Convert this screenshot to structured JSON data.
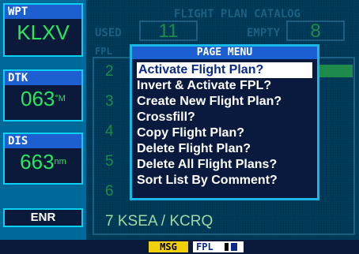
{
  "sidebar": {
    "wpt": {
      "label": "WPT",
      "value": "KLXV"
    },
    "dtk": {
      "label": "DTK",
      "value": "063",
      "unit": "°M"
    },
    "dis": {
      "label": "DIS",
      "value": "663",
      "unit": "nm"
    },
    "mode": "ENR"
  },
  "catalog": {
    "title": "FLIGHT PLAN CATALOG",
    "used_label": "USED",
    "used_value": "11",
    "empty_label": "EMPTY",
    "empty_value": "8",
    "fpl_label": "FPL",
    "rows": [
      "2",
      "3",
      "4",
      "5",
      "6",
      "7 KSEA / KCRQ"
    ]
  },
  "menu": {
    "title": "PAGE MENU",
    "items": [
      "Activate Flight Plan?",
      "Invert & Activate FPL?",
      "Create New Flight Plan?",
      "Crossfill?",
      "Copy Flight Plan?",
      "Delete Flight Plan?",
      "Delete All Flight Plans?",
      "Sort List By Comment?"
    ]
  },
  "status_bar": {
    "msg": "MSG",
    "page": "FPL"
  },
  "colors": {
    "accent_cyan": "#0cd0f0",
    "value_green": "#27e85b",
    "msg_yellow": "#f2d10a"
  }
}
